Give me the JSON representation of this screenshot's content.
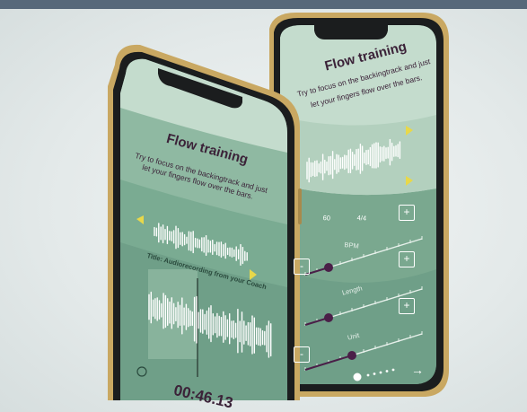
{
  "colors": {
    "screen_dark": "#6f9f88",
    "screen_mid": "#8fb9a2",
    "screen_light": "#c4dccd",
    "accent_purple": "#4a1f48",
    "accent_yellow": "#e8d84a",
    "frame_gold": "#c9a862",
    "bezel": "#1b1d1e",
    "top_bar": "#57687a"
  },
  "front_phone": {
    "title": "Flow training",
    "subtitle_line1": "Try to focus on the backingtrack and just",
    "subtitle_line2": "let your fingers flow over the bars.",
    "recording_title": "Title: Audiorecording from your Coach",
    "timer": "00:46.13",
    "icons": [
      "play-back-icon",
      "play-forward-icon",
      "timer-icon"
    ]
  },
  "back_phone": {
    "title": "Flow training",
    "subtitle_line1": "Try to focus on the backingtrack and just",
    "subtitle_line2": "let your fingers flow over the bars.",
    "tempo_value": "60",
    "time_signature": "4/4",
    "bpm_label": "BPM",
    "length_label": "Length",
    "unit_label": "Unit",
    "plus_label": "+",
    "minus_label": "-",
    "next_arrow": "→",
    "slider_levels": {
      "bpm": 0.2,
      "length": 0.2,
      "unit": 0.4
    },
    "icons": [
      "play-icon",
      "contrast-icon",
      "arrow-right-icon",
      "plus-icon",
      "minus-icon"
    ]
  }
}
